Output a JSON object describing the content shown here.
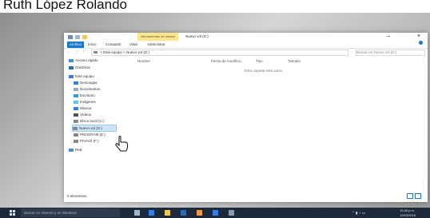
{
  "caption": {
    "text": "Ruth López Rolando"
  },
  "window": {
    "title": "Nuevo vol (D:)",
    "contextual_tab_group": "Herramientas de unidad",
    "controls": {
      "minimize": "–",
      "close": "×"
    }
  },
  "ribbon": {
    "tabs": [
      "Archivo",
      "Inicio",
      "Compartir",
      "Vista",
      "Administrar"
    ]
  },
  "address_bar": {
    "back": "←",
    "forward": "→",
    "up": "↑",
    "path": [
      "Este equipo",
      "Nuevo vol (D:)"
    ],
    "separator": ">",
    "search_placeholder": "Buscar en Nuevo vol (D:)"
  },
  "columns": [
    "Nombre",
    "Fecha de modifica...",
    "Tipo",
    "Tamaño"
  ],
  "empty_message": "Esta carpeta está vacía.",
  "sidebar": {
    "items": [
      {
        "label": "Acceso rápido",
        "icon": "star-icon"
      },
      {
        "label": "OneDrive",
        "icon": "cloud-icon"
      },
      {
        "label": "Este equipo",
        "icon": "computer-icon"
      },
      {
        "label": "Descargas",
        "icon": "download-icon"
      },
      {
        "label": "Documentos",
        "icon": "document-icon"
      },
      {
        "label": "Escritorio",
        "icon": "desktop-icon"
      },
      {
        "label": "Imágenes",
        "icon": "image-icon"
      },
      {
        "label": "Música",
        "icon": "music-icon"
      },
      {
        "label": "Vídeos",
        "icon": "video-icon"
      },
      {
        "label": "Disco local (C:)",
        "icon": "drive-icon"
      },
      {
        "label": "Nuevo vol (D:)",
        "icon": "drive-icon",
        "selected": true
      },
      {
        "label": "PROGRAM (E:)",
        "icon": "drive-icon"
      },
      {
        "label": "PIVAVZ (F:)",
        "icon": "drive-icon"
      },
      {
        "label": "Red",
        "icon": "network-icon"
      }
    ]
  },
  "status_bar": {
    "text": "0 elementos"
  },
  "taskbar": {
    "search_placeholder": "Buscar en Internet y en Windows",
    "clock_time": "10:36 p.m.",
    "clock_date": "12/03/2016"
  },
  "colors": {
    "accent": "#1979ca",
    "selection": "#cde6f7",
    "taskbar": "#1e2a3a"
  }
}
